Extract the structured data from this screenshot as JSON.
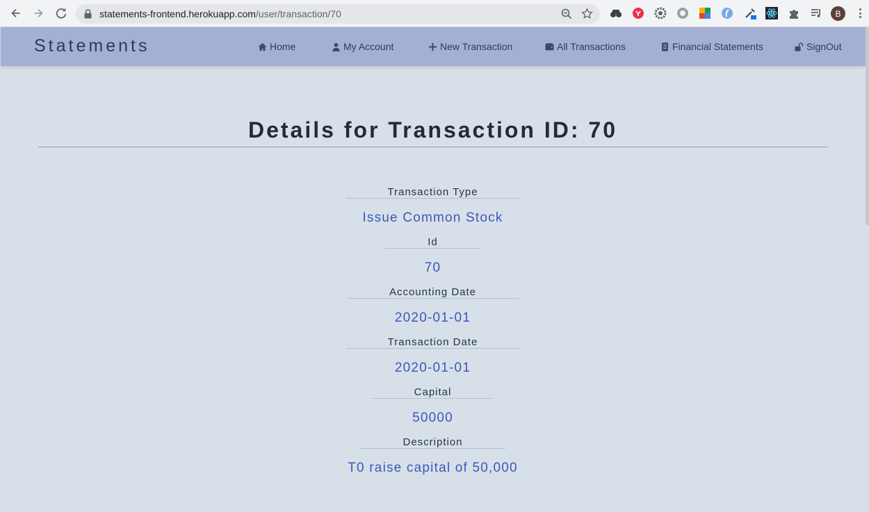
{
  "browser": {
    "url_host": "statements-frontend.herokuapp.com",
    "url_path": "/user/transaction/70",
    "avatar_letter": "B"
  },
  "app": {
    "brand": "Statements",
    "nav": {
      "home": "Home",
      "my_account": "My Account",
      "new_transaction": "New Transaction",
      "all_transactions": "All Transactions",
      "financial_statements": "Financial Statements",
      "sign_out": "SignOut"
    }
  },
  "page": {
    "title": "Details for Transaction ID: 70",
    "fields": [
      {
        "label": "Transaction Type",
        "value": "Issue Common Stock"
      },
      {
        "label": "Id",
        "value": "70"
      },
      {
        "label": "Accounting Date",
        "value": "2020-01-01"
      },
      {
        "label": "Transaction Date",
        "value": "2020-01-01"
      },
      {
        "label": "Capital",
        "value": "50000"
      },
      {
        "label": "Description",
        "value": "T0 raise capital of 50,000"
      }
    ]
  },
  "colors": {
    "navbar": "#a3b0d3",
    "background": "#d7e0e8",
    "value_text": "#3c57bb",
    "label_text": "#24334d"
  }
}
